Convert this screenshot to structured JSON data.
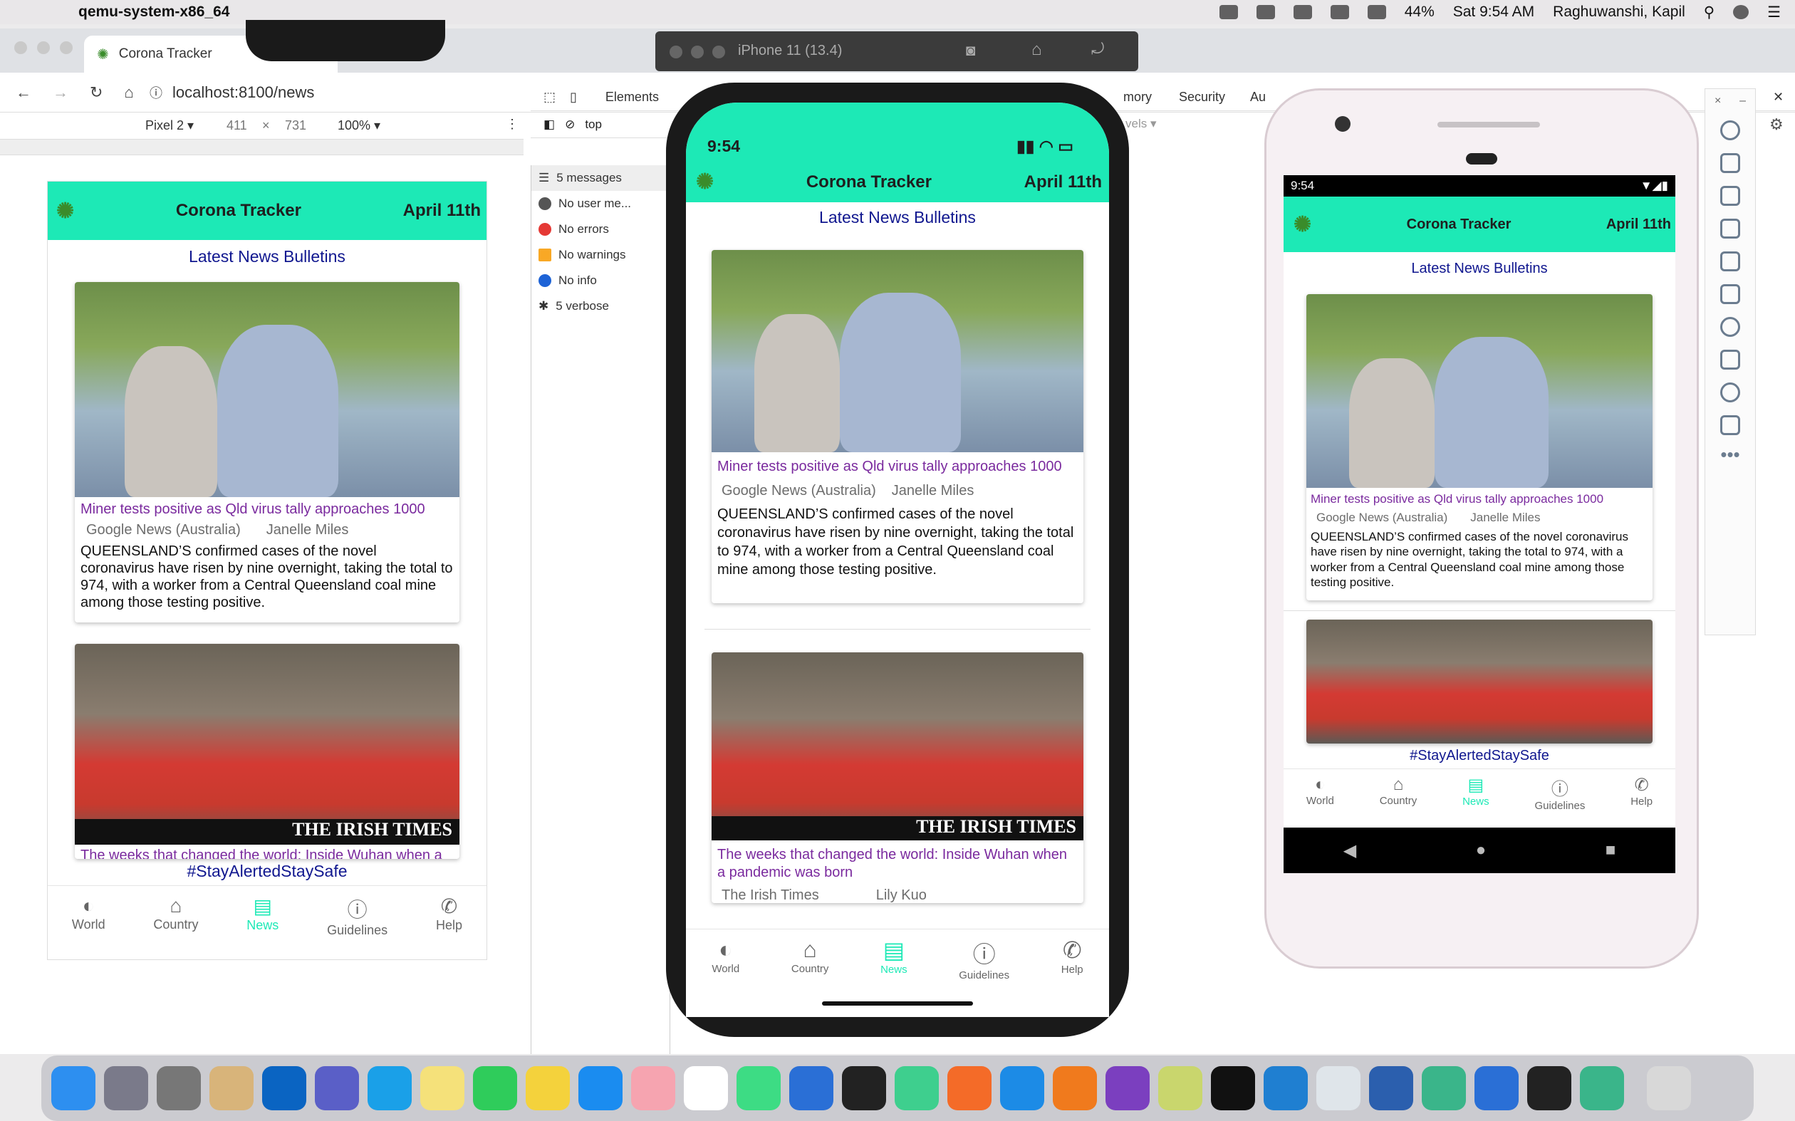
{
  "menubar": {
    "app_name": "qemu-system-x86_64",
    "battery": "44%",
    "clock": "Sat 9:54 AM",
    "user": "Raghuwanshi, Kapil"
  },
  "browser": {
    "tab_title": "Corona Tracker",
    "url": "localhost:8100/news",
    "device": "Pixel 2",
    "width": "411",
    "height": "731",
    "zoom": "100%",
    "devtools_tabs": [
      "Elements",
      "mory",
      "Security",
      "Au"
    ],
    "console_context": "top",
    "levels": "vels"
  },
  "console": {
    "rows": [
      "5 messages",
      "No user me...",
      "No errors",
      "No warnings",
      "No info",
      "5 verbose"
    ]
  },
  "simulator": {
    "title": "iPhone 11 (13.4)"
  },
  "app": {
    "title": "Corona Tracker",
    "date": "April 11th",
    "bulletins": "Latest News Bulletins",
    "hashtag": "#StayAlertedStaySafe",
    "card1": {
      "title": "Miner tests positive as Qld virus tally approaches 1000",
      "source": "Google News (Australia)",
      "author": "Janelle Miles",
      "body": "QUEENSLAND’S confirmed cases of the novel coronavirus have risen by nine overnight, taking the total to 974, with a worker from a Central Queensland coal mine among those testing positive."
    },
    "card2": {
      "title": "The weeks that changed the world: Inside Wuhan when a pandemic was born",
      "source": "The Irish Times",
      "author": "Lily Kuo",
      "caption": "THE IRISH TIMES"
    },
    "tabs": [
      "World",
      "Country",
      "News",
      "Guidelines",
      "Help"
    ]
  },
  "iphone_status": {
    "time": "9:54"
  },
  "android_status": {
    "time": "9:54"
  },
  "colors": {
    "accent": "#1de9b6",
    "bulletin": "#10178f",
    "title": "#7a2a9e"
  }
}
